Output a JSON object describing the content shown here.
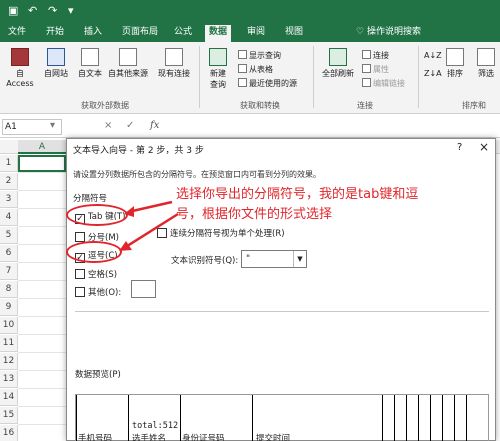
{
  "titlebar": {
    "icons": [
      "save-icon",
      "undo-icon",
      "redo-icon",
      "qa-dropdown-icon"
    ],
    "color": "#217346"
  },
  "tabs": [
    {
      "label": "文件"
    },
    {
      "label": "开始"
    },
    {
      "label": "插入"
    },
    {
      "label": "页面布局"
    },
    {
      "label": "公式"
    },
    {
      "label": "数据"
    },
    {
      "label": "审阅"
    },
    {
      "label": "视图"
    }
  ],
  "active_tab": "数据",
  "tell_me": "操作说明搜索",
  "ribbon": {
    "get_external": {
      "buttons": [
        "自 Access",
        "自网站",
        "自文本",
        "自其他来源",
        "现有连接"
      ],
      "group_label": "获取外部数据"
    },
    "get_transform": {
      "new_query_line1": "新建",
      "new_query_line2": "查询",
      "small": [
        "显示查询",
        "从表格",
        "最近使用的源"
      ],
      "group_label": "获取和转换"
    },
    "connections": {
      "refresh_line1": "全部刷新",
      "small": [
        "连接",
        "属性",
        "编辑链接"
      ],
      "group_label": "连接"
    },
    "sort": {
      "sort_label": "排序",
      "filter_label": "筛选",
      "group_label": "排序和"
    }
  },
  "formula_bar": {
    "name_box": "A1",
    "fx": "fx",
    "cancel": "×",
    "enter": "✓"
  },
  "sheet": {
    "column": "A",
    "rows": [
      "1",
      "2",
      "3",
      "4",
      "5",
      "6",
      "7",
      "8",
      "9",
      "10",
      "11",
      "12",
      "13",
      "14",
      "15",
      "16"
    ]
  },
  "dialog": {
    "title": "文本导入向导 - 第 2 步，共 3 步",
    "help": "?",
    "close": "×",
    "description": "请设置分列数据所包含的分隔符号。在预览窗口内可看到分列的效果。",
    "frame_title": "分隔符号",
    "options": [
      {
        "label": "Tab 键(T)",
        "checked": true
      },
      {
        "label": "分号(M)",
        "checked": false
      },
      {
        "label": "逗号(C)",
        "checked": true
      },
      {
        "label": "空格(S)",
        "checked": false
      },
      {
        "label": "其他(O):",
        "checked": false
      }
    ],
    "consecutive_label": "连续分隔符号视为单个处理(R)",
    "qualifier_label": "文本识别符号(Q):",
    "qualifier_value": "\"",
    "preview_title": "数据预览(P)",
    "preview": {
      "cells": [
        "total:512",
        "手机号码",
        "选手姓名",
        "身份证号码",
        "提交时间"
      ]
    }
  },
  "annotation": {
    "line1": "选择你导出的分隔符号，我的是tab键和逗",
    "line2": "号，根据你文件的形式选择",
    "color": "#e0262c"
  }
}
